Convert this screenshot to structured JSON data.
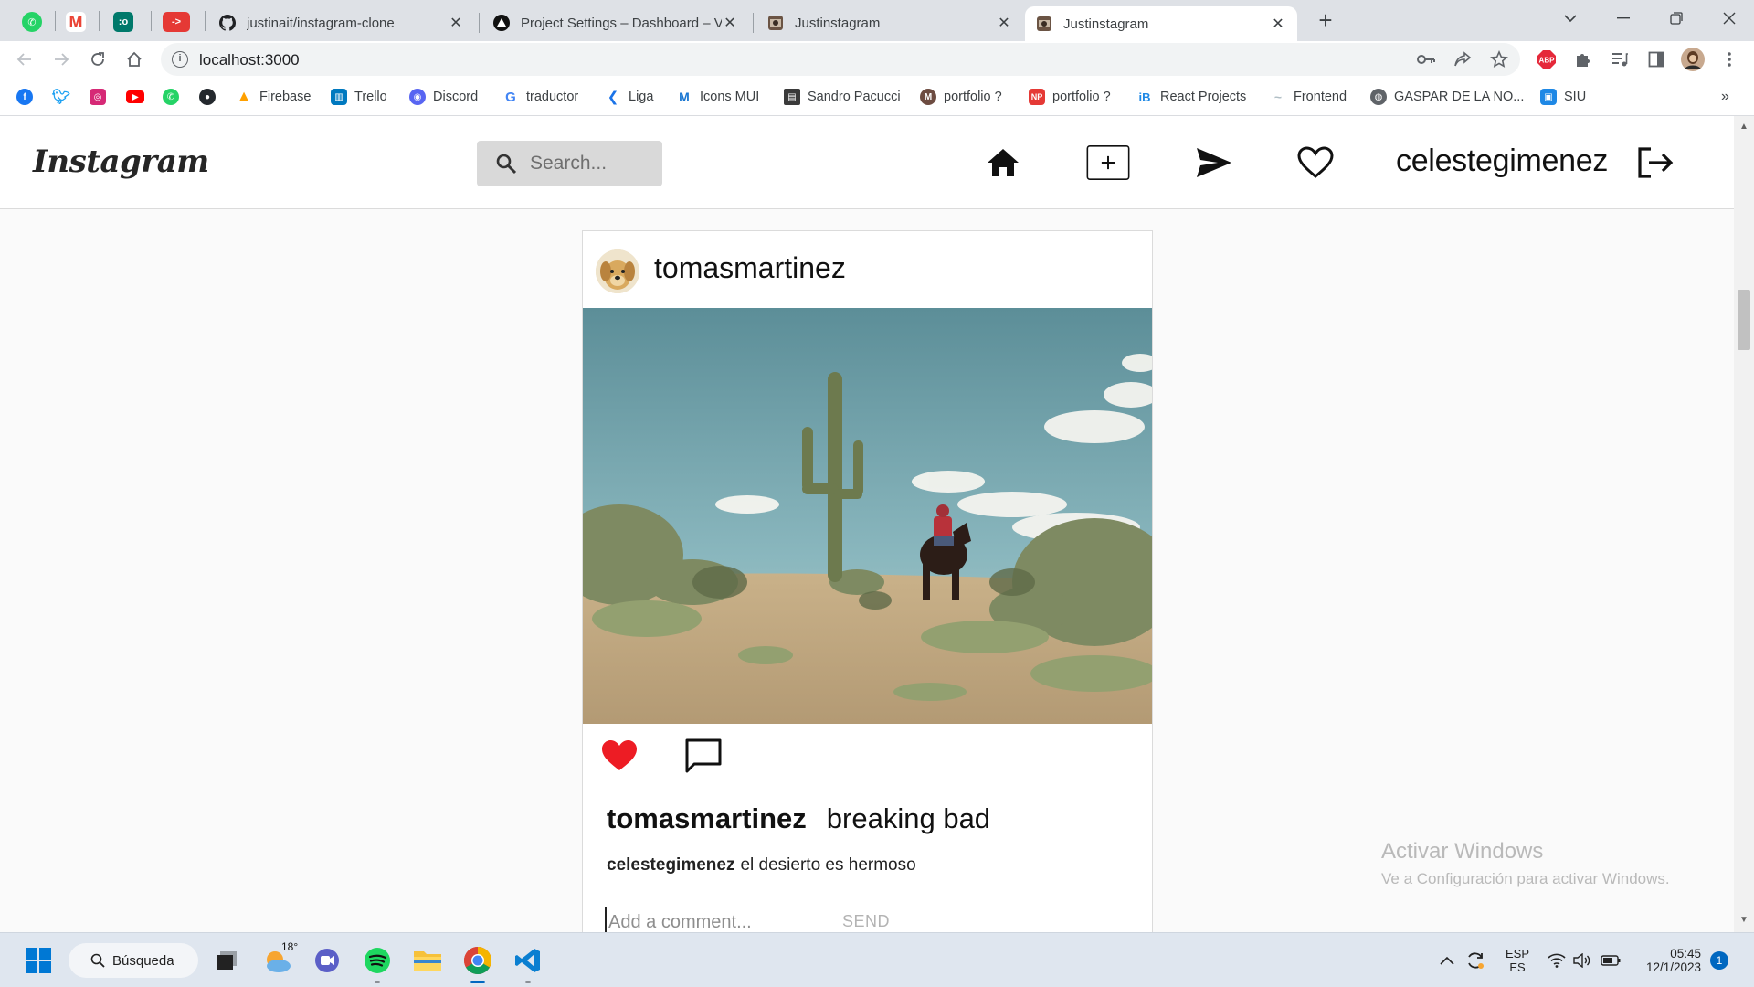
{
  "browser": {
    "pinned_tabs": [
      {
        "icon": "whatsapp-icon",
        "color": "#25d366"
      },
      {
        "icon": "gmail-icon",
        "color": "#ea4335"
      },
      {
        "icon": "app-icon",
        "color": "#00796b",
        "text": ":o"
      },
      {
        "icon": "youtube-app-icon",
        "color": "#e53935",
        "text": "->"
      }
    ],
    "tabs": [
      {
        "title": "justinait/instagram-clone",
        "icon": "github-icon",
        "close": "✕"
      },
      {
        "title": "Project Settings – Dashboard – V",
        "icon": "vercel-icon",
        "close": "✕"
      },
      {
        "title": "Justinstagram",
        "icon": "instagram-tab-icon",
        "close": "✕"
      },
      {
        "title": "Justinstagram",
        "icon": "instagram-tab-icon",
        "close": "✕"
      }
    ],
    "new_tab": "+",
    "url": "localhost:3000",
    "bookmarks": [
      {
        "label": "",
        "icon": "facebook-icon",
        "color": "#1877f2",
        "text": "f"
      },
      {
        "label": "",
        "icon": "twitter-icon",
        "color": "#1da1f2",
        "text": "t"
      },
      {
        "label": "",
        "icon": "instagram-icon",
        "color": "#d62976",
        "text": "◎"
      },
      {
        "label": "",
        "icon": "youtube-icon",
        "color": "#ff0000",
        "text": "▶"
      },
      {
        "label": "",
        "icon": "whatsapp-icon",
        "color": "#25d366",
        "text": "✆"
      },
      {
        "label": "",
        "icon": "github-icon",
        "color": "#24292e",
        "text": "●"
      },
      {
        "label": "Firebase",
        "icon": "firebase-icon",
        "color": "#ffa000",
        "text": "▲"
      },
      {
        "label": "Trello",
        "icon": "trello-icon",
        "color": "#0079bf",
        "text": "▥"
      },
      {
        "label": "Discord",
        "icon": "discord-icon",
        "color": "#5865f2",
        "text": "◉"
      },
      {
        "label": "traductor",
        "icon": "google-icon",
        "color": "#4285f4",
        "text": "G"
      },
      {
        "label": "Liga",
        "icon": "liga-icon",
        "color": "#1a73e8",
        "text": "❮"
      },
      {
        "label": "Icons MUI",
        "icon": "mui-icon",
        "color": "#1976d2",
        "text": "M"
      },
      {
        "label": "Sandro Pacucci",
        "icon": "sandro-icon",
        "color": "#3a3a3a",
        "text": "▤"
      },
      {
        "label": "portfolio ?",
        "icon": "medium-icon",
        "color": "#6d4c41",
        "text": "M"
      },
      {
        "label": "portfolio ?",
        "icon": "np-icon",
        "color": "#e53935",
        "text": "NP"
      },
      {
        "label": "React Projects",
        "icon": "react-projects-icon",
        "color": "#1e88e5",
        "text": "iB"
      },
      {
        "label": "Frontend",
        "icon": "frontend-icon",
        "color": "#b0bec5",
        "text": "~"
      },
      {
        "label": "GASPAR DE LA NO...",
        "icon": "globe-icon",
        "color": "#5f6368",
        "text": "◍"
      },
      {
        "label": "SIU",
        "icon": "siu-icon",
        "color": "#1e88e5",
        "text": "▣"
      }
    ],
    "more_bookmarks": "»"
  },
  "app": {
    "logo": "Instagram",
    "search_placeholder": "Search...",
    "current_user": "celestegimenez",
    "post": {
      "username": "tomasmartinez",
      "caption_user": "tomasmartinez",
      "caption_text": "breaking bad",
      "liked": true,
      "comments": [
        {
          "user": "celestegimenez",
          "text": "el desierto es hermoso"
        }
      ],
      "comment_placeholder": "Add a comment...",
      "send_label": "SEND"
    }
  },
  "watermark": {
    "line1": "Activar Windows",
    "line2": "Ve a Configuración para activar Windows."
  },
  "taskbar": {
    "search_label": "Búsqueda",
    "weather": "18°",
    "lang_top": "ESP",
    "lang_bottom": "ES",
    "time": "05:45",
    "date": "12/1/2023",
    "notifications": "1"
  }
}
